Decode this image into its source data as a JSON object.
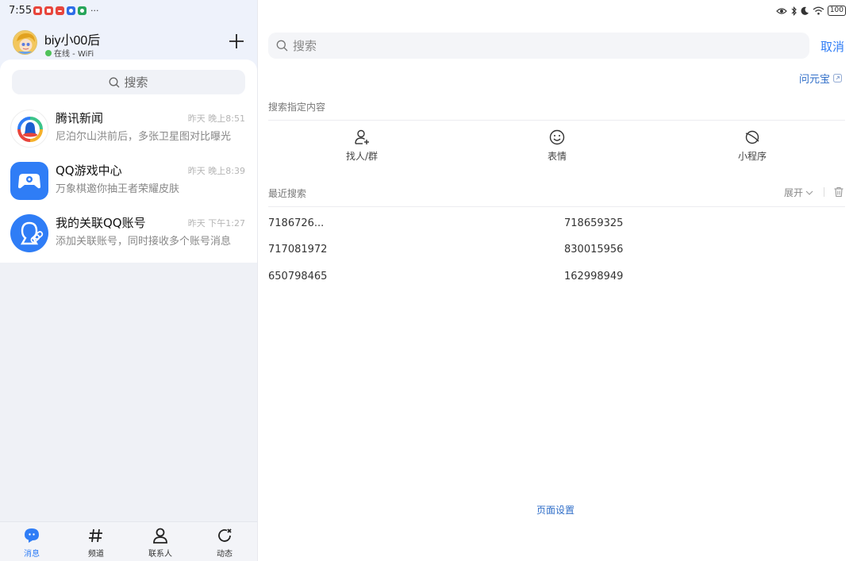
{
  "status": {
    "time": "7:55",
    "battery": "100"
  },
  "profile": {
    "name": "biy小00后",
    "status": "在线 - WiFi"
  },
  "left_search": {
    "label": "搜索"
  },
  "chats": [
    {
      "title": "腾讯新闻",
      "time": "昨天 晚上8:51",
      "preview": "尼泊尔山洪前后，多张卫星图对比曝光"
    },
    {
      "title": "QQ游戏中心",
      "time": "昨天 晚上8:39",
      "preview": "万象棋邀你抽王者荣耀皮肤"
    },
    {
      "title": "我的关联QQ账号",
      "time": "昨天 下午1:27",
      "preview": "添加关联账号，同时接收多个账号消息"
    }
  ],
  "nav": [
    {
      "label": "消息",
      "icon": "chat-icon",
      "active": true
    },
    {
      "label": "频道",
      "icon": "hash-icon",
      "active": false
    },
    {
      "label": "联系人",
      "icon": "person-icon",
      "active": false
    },
    {
      "label": "动态",
      "icon": "refresh-icon",
      "active": false
    }
  ],
  "search": {
    "placeholder": "搜索",
    "cancel": "取消"
  },
  "wenyuanbao": "问元宝",
  "specified": {
    "title": "搜索指定内容",
    "items": [
      {
        "label": "找人/群",
        "icon": "add-person-icon"
      },
      {
        "label": "表情",
        "icon": "smiley-icon"
      },
      {
        "label": "小程序",
        "icon": "mini-program-icon"
      }
    ]
  },
  "recent": {
    "title": "最近搜索",
    "expand": "展开",
    "items": [
      "7186726...",
      "718659325",
      "717081972",
      "830015956",
      "650798465",
      "162998949"
    ]
  },
  "page_settings": "页面设置",
  "colors": {
    "accent": "#2f7df6",
    "left_bg": "#eff1f6",
    "online": "#4fc25a"
  }
}
